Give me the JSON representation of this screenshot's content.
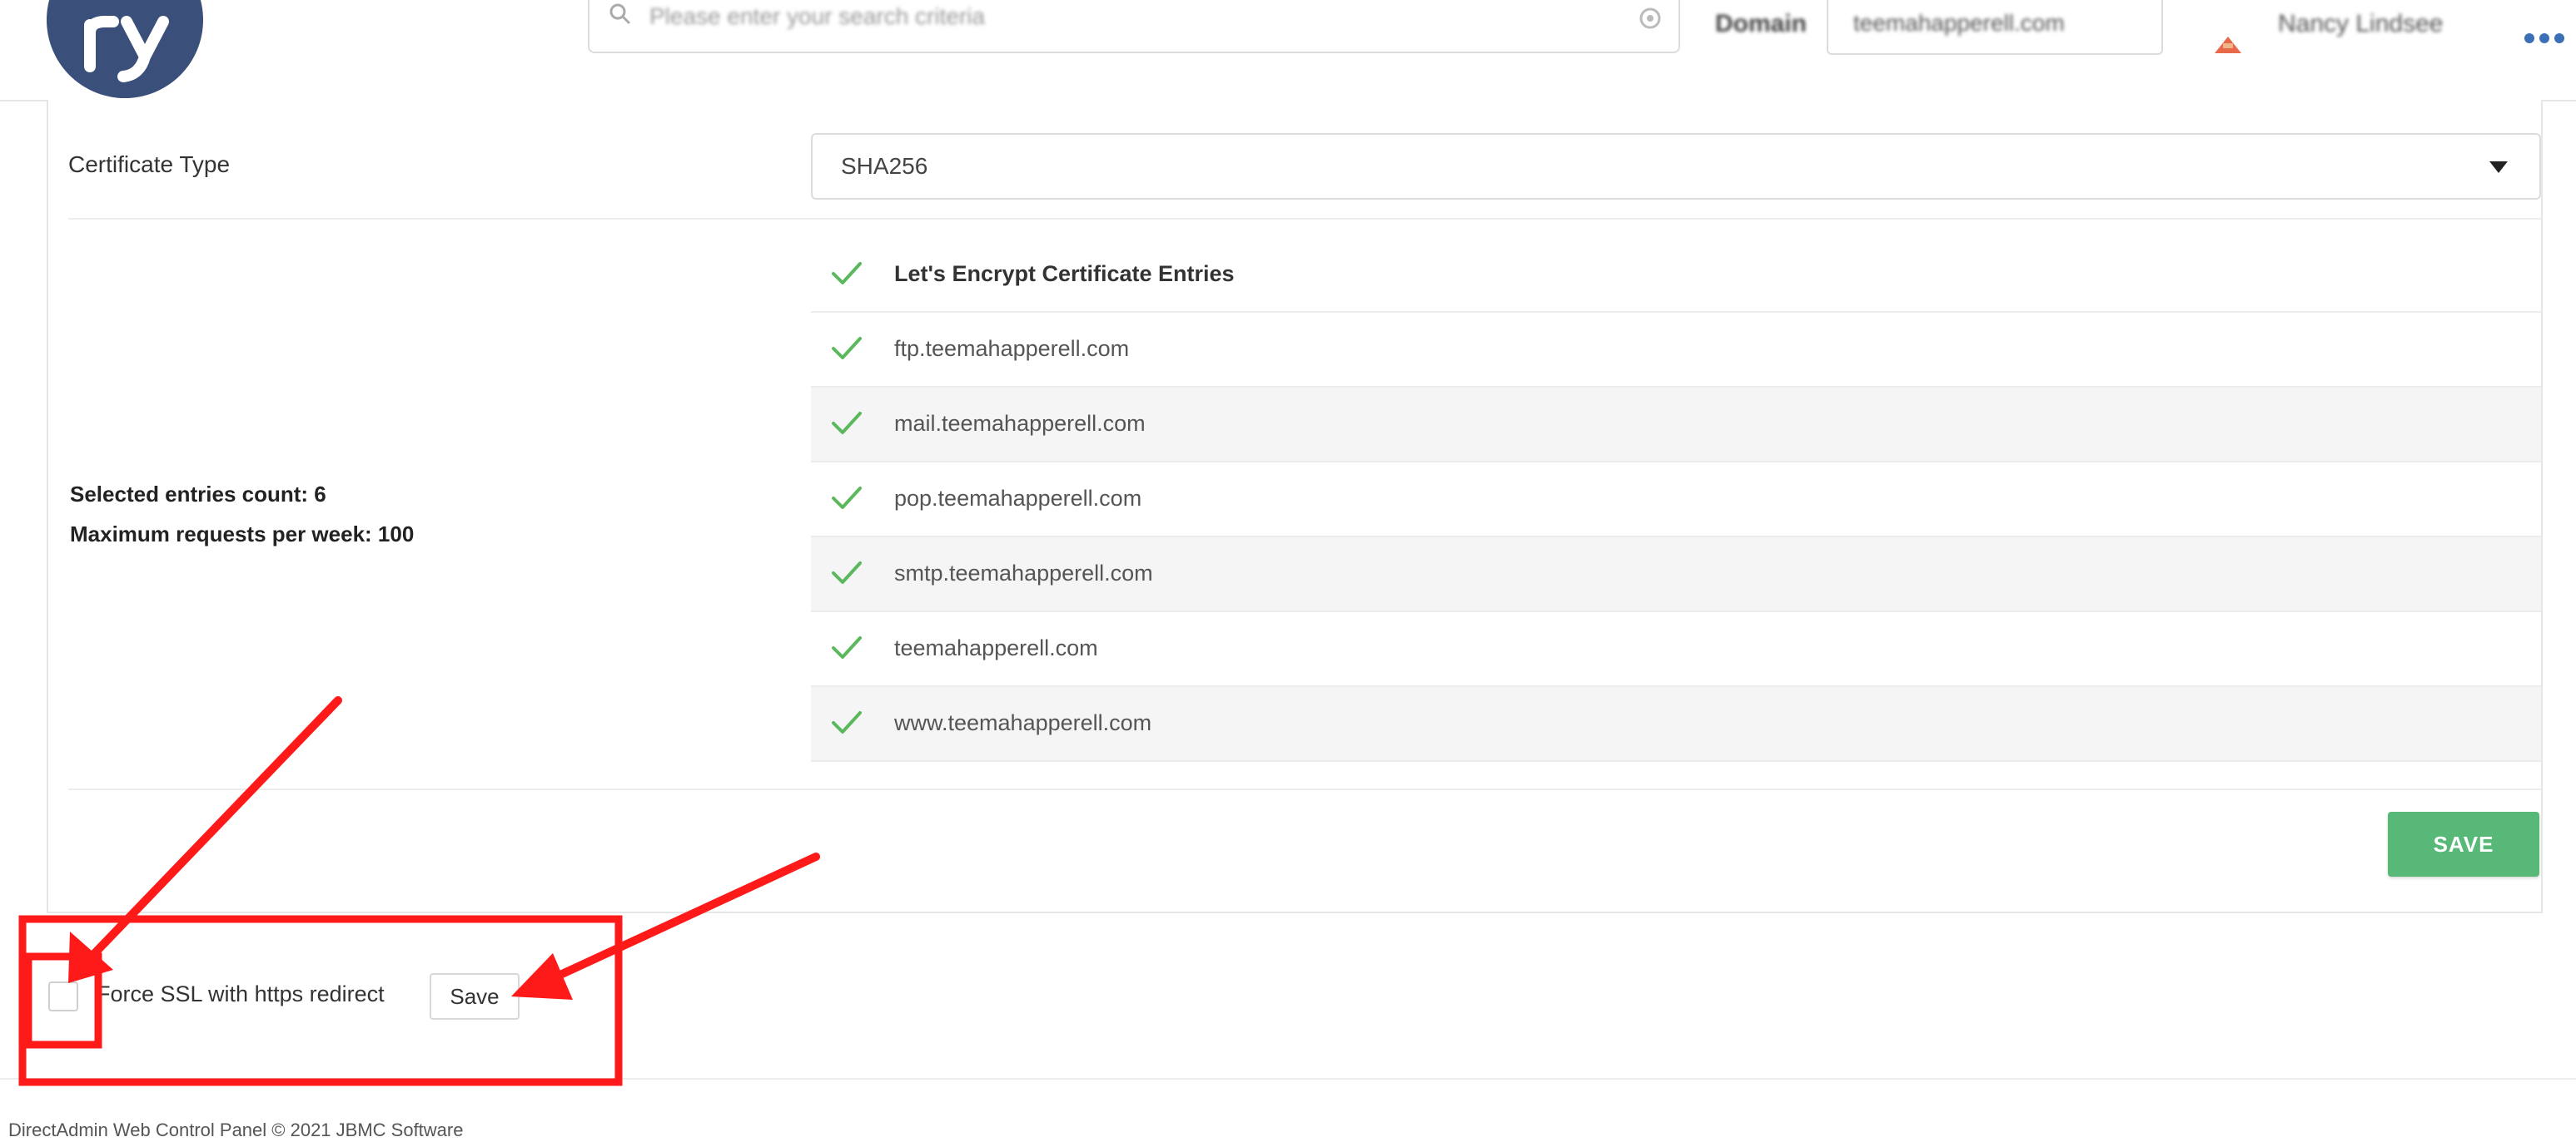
{
  "header": {
    "search_placeholder": "Please enter your search criteria",
    "domain_label": "Domain",
    "domain_value": "teemahapperell.com",
    "user_name": "Nancy Lindsee"
  },
  "certificate": {
    "type_label": "Certificate Type",
    "type_value": "SHA256"
  },
  "entries": {
    "header_label": "Let's Encrypt Certificate Entries",
    "items": [
      "ftp.teemahapperell.com",
      "mail.teemahapperell.com",
      "pop.teemahapperell.com",
      "smtp.teemahapperell.com",
      "teemahapperell.com",
      "www.teemahapperell.com"
    ],
    "selected_count_text": "Selected entries count: 6",
    "max_requests_text": "Maximum requests per week: 100",
    "checked": true
  },
  "actions": {
    "save_label": "SAVE",
    "force_ssl_label": "Force SSL with https redirect",
    "force_ssl_checked": false,
    "small_save_label": "Save"
  },
  "footer": {
    "text": "DirectAdmin Web Control Panel © 2021 JBMC Software"
  },
  "colors": {
    "accent_green": "#58b877",
    "check_green": "#5cb85c",
    "annotation_red": "#ff1a1a",
    "logo_blue": "#3a4f7a"
  },
  "icons": {
    "search": "search-icon",
    "check": "check-icon",
    "caret": "caret-down-icon",
    "more": "more-dots-icon"
  }
}
